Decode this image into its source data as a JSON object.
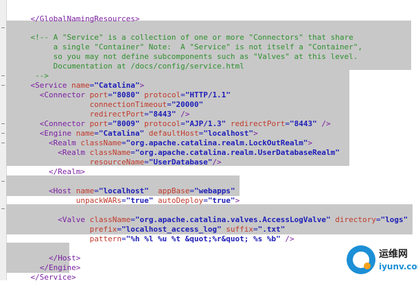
{
  "editor": {
    "lines": {
      "l1": {
        "text": "</GlobalNamingResources>"
      },
      "l2": {
        "text": "<!-- A \"Service\" is a collection of one or more \"Connectors\" that share"
      },
      "l3": {
        "text": "     a single \"Container\" Note:  A \"Service\" is not itself a \"Container\","
      },
      "l4": {
        "text": "     so you may not define subcomponents such as \"Valves\" at this level."
      },
      "l5": {
        "text": "     Documentation at /docs/config/service.html"
      },
      "l6": {
        "text": " -->"
      },
      "l7": {
        "open": "<Service ",
        "a1": "name",
        "v1": "\"Catalina\"",
        "close": ">"
      },
      "l8": {
        "open": "  <Connector ",
        "a1": "port",
        "v1": "\"8080\"",
        "a2": " protocol",
        "v2": "\"HTTP/1.1\""
      },
      "l9": {
        "a1": "             connectionTimeout",
        "v1": "\"20000\""
      },
      "l10": {
        "a1": "             redirectPort",
        "v1": "\"8443\"",
        "close": " />"
      },
      "l11": {
        "open": "  <Connector ",
        "a1": "port",
        "v1": "\"8009\"",
        "a2": " protocol",
        "v2": "\"AJP/1.3\"",
        "a3": " redirectPort",
        "v3": "\"8443\"",
        "close": " />"
      },
      "l12": {
        "open": "  <Engine ",
        "a1": "name",
        "v1": "\"Catalina\"",
        "a2": " defaultHost",
        "v2": "\"localhost\"",
        "close": ">"
      },
      "l13": {
        "open": "    <Realm ",
        "a1": "className",
        "v1": "\"org.apache.catalina.realm.LockOutRealm\"",
        "close": ">"
      },
      "l14": {
        "open": "      <Realm ",
        "a1": "className",
        "v1": "\"org.apache.catalina.realm.UserDatabaseRealm\""
      },
      "l15": {
        "a1": "             resourceName",
        "v1": "\"UserDatabase\"",
        "close": "/>"
      },
      "l16": {
        "text": "    </Realm>"
      },
      "l17": {
        "open": "    <Host ",
        "a1": "name",
        "v1": "\"localhost\"",
        "a2": "  appBase",
        "v2": "\"webapps\""
      },
      "l18": {
        "a1": "          unpackWARs",
        "v1": "\"true\"",
        "a2": " autoDeploy",
        "v2": "\"true\"",
        "close": ">"
      },
      "l19": {
        "open": "      <Valve ",
        "a1": "className",
        "v1": "\"org.apache.catalina.valves.AccessLogValve\"",
        "a2": " directory",
        "v2": "\"logs\""
      },
      "l20": {
        "a1": "             prefix",
        "v1": "\"localhost_access_log\"",
        "a2": " suffix",
        "v2": "\".txt\""
      },
      "l21": {
        "a1": "             pattern",
        "v1": "\"%h %l %u %t &quot;%r&quot; %s %b\"",
        "close": " />"
      },
      "l22": {
        "text": "    </Host>"
      },
      "l23": {
        "text": "  </Engine>"
      },
      "l24": {
        "text": "</Service>"
      }
    },
    "eq": "="
  },
  "watermark": {
    "cn": "运维网",
    "url": "iyunv.com"
  },
  "colors": {
    "comment": "#2f8f2f",
    "tag": "#7a1fa2",
    "attr": "#c0392b",
    "value": "#1d1db8",
    "selection": "#c8c8c8"
  }
}
